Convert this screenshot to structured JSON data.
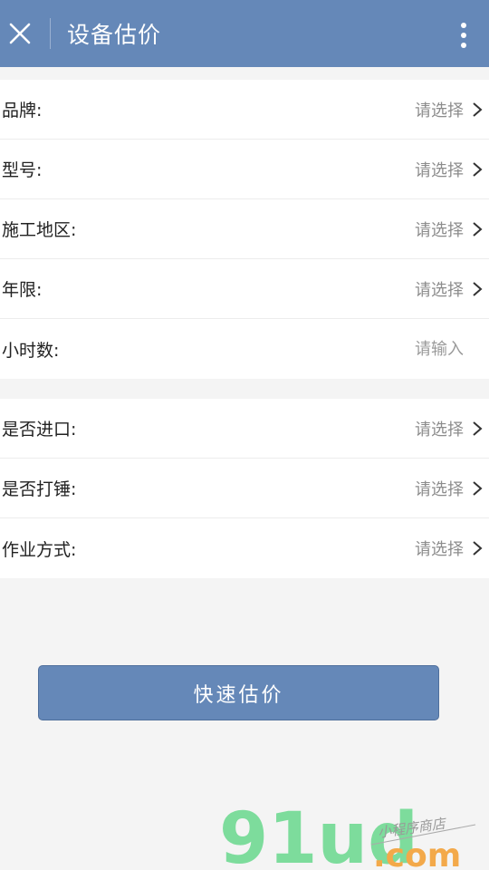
{
  "header": {
    "title": "设备估价",
    "close_icon": "close-icon",
    "more_icon": "more-vertical-icon",
    "bg_color": "#6588b8"
  },
  "form": {
    "group1": [
      {
        "label": "品牌:",
        "value": "请选择",
        "type": "select"
      },
      {
        "label": "型号:",
        "value": "请选择",
        "type": "select"
      },
      {
        "label": "施工地区:",
        "value": "请选择",
        "type": "select"
      },
      {
        "label": "年限:",
        "value": "请选择",
        "type": "select"
      },
      {
        "label": "小时数:",
        "placeholder": "请输入",
        "type": "input"
      }
    ],
    "group2": [
      {
        "label": "是否进口:",
        "value": "请选择",
        "type": "select"
      },
      {
        "label": "是否打锤:",
        "value": "请选择",
        "type": "select"
      },
      {
        "label": "作业方式:",
        "value": "请选择",
        "type": "select"
      }
    ]
  },
  "submit_label": "快速估价",
  "watermark": {
    "brand": "91ud",
    "domain": ".com",
    "tagline": "小程序商店"
  }
}
